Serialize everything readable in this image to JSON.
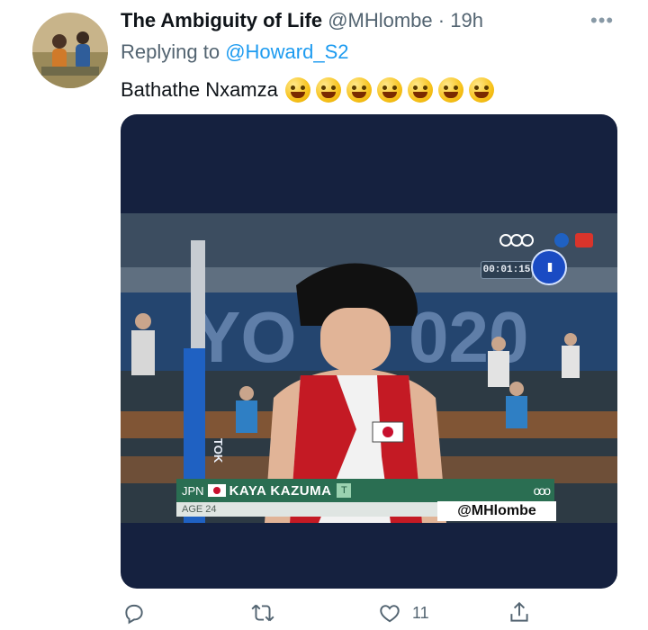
{
  "tweet": {
    "display_name": "The Ambiguity of Life",
    "handle": "@MHlombe",
    "separator": "·",
    "time": "19h",
    "more_label": "•••",
    "replying_prefix": "Replying to",
    "replying_to": "@Howard_S2",
    "text": "Bathathe Nxamza",
    "emojis": [
      "grinning-sweat-emoji",
      "grinning-sweat-emoji",
      "rofl-emoji",
      "joy-emoji",
      "rofl-emoji",
      "grinning-sweat-emoji",
      "zany-tongue-emoji"
    ]
  },
  "media": {
    "timer": "00:01:15",
    "pause_label": "II",
    "pillar_text": "TOK",
    "lower_third": {
      "country": "JPN",
      "name": "KAYA KAZUMA",
      "badge": "T",
      "age": "AGE 24",
      "rings": "ooo"
    },
    "watermark": "@MHlombe"
  },
  "actions": {
    "reply_count": "",
    "retweet_count": "",
    "like_count": "11",
    "share_count": ""
  },
  "colors": {
    "link": "#1d9bf0",
    "secondary": "#536471",
    "media_bg": "#15213f",
    "lower_third": "#2a6e52"
  }
}
